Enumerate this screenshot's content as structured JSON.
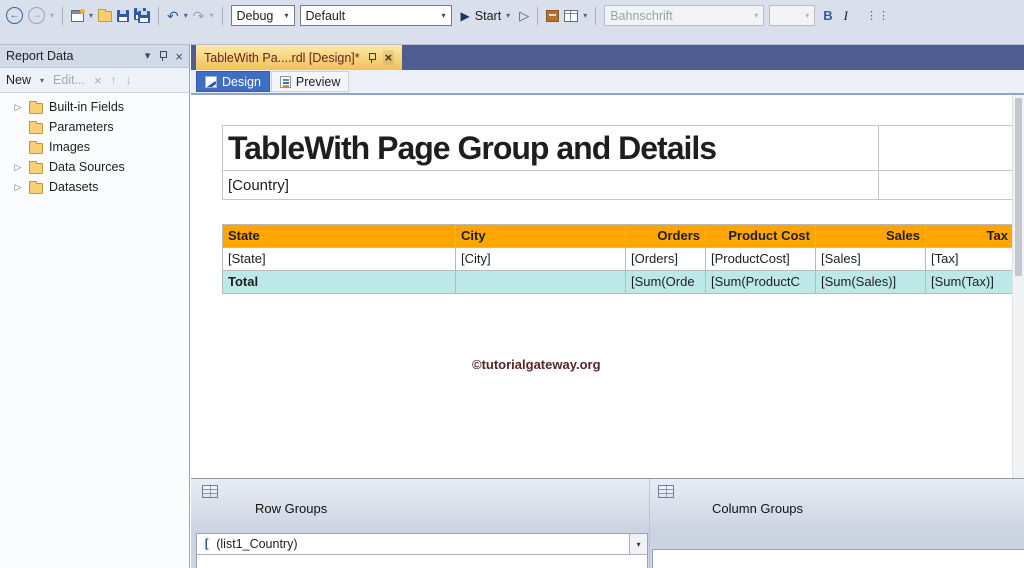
{
  "toolbar": {
    "debug_value": "Debug",
    "config_value": "Default",
    "start_label": "Start",
    "font_value": "Bahnschrift",
    "size_value": "",
    "bold_label": "B",
    "italic_label": "I"
  },
  "report_data_panel": {
    "title": "Report Data",
    "new_label": "New",
    "edit_label": "Edit...",
    "tree": [
      {
        "label": "Built-in Fields"
      },
      {
        "label": "Parameters"
      },
      {
        "label": "Images"
      },
      {
        "label": "Data Sources"
      },
      {
        "label": "Datasets"
      }
    ]
  },
  "document": {
    "tab_title": "TableWith Pa....rdl [Design]*",
    "design_label": "Design",
    "preview_label": "Preview"
  },
  "report": {
    "title": "TableWith Page Group and Details",
    "group_field": "[Country]",
    "watermark": "©tutorialgateway.org",
    "table": {
      "headers": [
        "State",
        "City",
        "Orders",
        "Product Cost",
        "Sales",
        "Tax"
      ],
      "detail_row": [
        "[State]",
        "[City]",
        "[Orders]",
        "[ProductCost]",
        "[Sales]",
        "[Tax]"
      ],
      "total_row": [
        "Total",
        "",
        "[Sum(Orde",
        "[Sum(ProductC",
        "[Sum(Sales)]",
        "[Sum(Tax)]"
      ]
    }
  },
  "grouping_pane": {
    "row_groups_label": "Row Groups",
    "column_groups_label": "Column Groups",
    "row_group_item": "(list1_Country)"
  },
  "colors": {
    "table_header_orange": "#FFA500",
    "total_row_teal": "#BCE8E8",
    "active_tab_gold": "#EEC15C",
    "document_well_blue": "#4E5E90",
    "design_tab_blue": "#3F6FC3"
  }
}
